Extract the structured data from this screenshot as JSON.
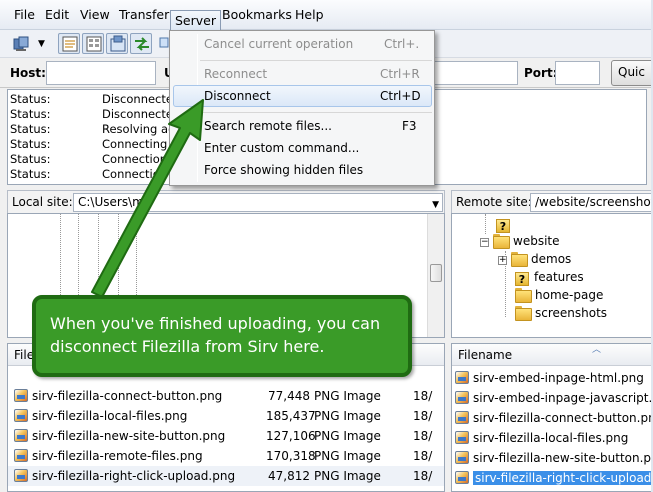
{
  "menubar": {
    "items": [
      "File",
      "Edit",
      "View",
      "Transfer",
      "Server",
      "Bookmarks",
      "Help"
    ]
  },
  "quickconnect": {
    "host_label": "Host:",
    "user_label_partial": "U",
    "port_label": "Port:",
    "button_partial": "Quic"
  },
  "log": {
    "rows": [
      {
        "k": "Status:",
        "v": "Disconnected"
      },
      {
        "k": "Status:",
        "v": "Disconnected"
      },
      {
        "k": "Status:",
        "v": "Resolving ad"
      },
      {
        "k": "Status:",
        "v": "Connecting t"
      },
      {
        "k": "Status:",
        "v": "Connection"
      },
      {
        "k": "Status:",
        "v": "Connection"
      }
    ]
  },
  "server_menu": {
    "items": [
      {
        "label": "Cancel current operation",
        "shortcut": "Ctrl+.",
        "disabled": true
      },
      {
        "label": "Reconnect",
        "shortcut": "Ctrl+R",
        "disabled": true
      },
      {
        "label": "Disconnect",
        "shortcut": "Ctrl+D",
        "disabled": false,
        "highlighted": true
      },
      {
        "label": "Search remote files...",
        "shortcut": "F3",
        "disabled": false
      },
      {
        "label": "Enter custom command...",
        "shortcut": "",
        "disabled": false
      },
      {
        "label": "Force showing hidden files",
        "shortcut": "",
        "disabled": false
      }
    ]
  },
  "local_site": {
    "label": "Local site:",
    "path": "C:\\Users\\m"
  },
  "remote_site": {
    "label": "Remote site:",
    "path": "/website/screenshots"
  },
  "remote_tree": {
    "items": [
      {
        "name": "?",
        "type": "unknown"
      },
      {
        "name": "website",
        "type": "folder-open"
      },
      {
        "name": "demos",
        "type": "folder"
      },
      {
        "name": "features",
        "type": "unknown"
      },
      {
        "name": "home-page",
        "type": "folder"
      },
      {
        "name": "screenshots",
        "type": "folder"
      }
    ]
  },
  "local_list": {
    "header_partial": "File",
    "rows": [
      {
        "name": "sirv-filezilla-connect-button.png",
        "size": "77,448",
        "type": "PNG Image",
        "extra": "18/"
      },
      {
        "name": "sirv-filezilla-local-files.png",
        "size": "185,437",
        "type": "PNG Image",
        "extra": "18/"
      },
      {
        "name": "sirv-filezilla-new-site-button.png",
        "size": "127,106",
        "type": "PNG Image",
        "extra": "18/"
      },
      {
        "name": "sirv-filezilla-remote-files.png",
        "size": "170,318",
        "type": "PNG Image",
        "extra": "18/"
      },
      {
        "name": "sirv-filezilla-right-click-upload.png",
        "size": "47,812",
        "type": "PNG Image",
        "extra": "18/"
      }
    ]
  },
  "remote_list": {
    "header": "Filename",
    "rows": [
      "sirv-embed-inpage-html.png",
      "sirv-embed-inpage-javascript.pn",
      "sirv-filezilla-connect-button.png",
      "sirv-filezilla-local-files.png",
      "sirv-filezilla-new-site-button.png",
      "sirv-filezilla-right-click-upload.pr"
    ]
  },
  "callout": {
    "text": "When you've finished uploading, you can disconnect Filezilla from Sirv here."
  },
  "colors": {
    "callout_fill": "#3a9b28",
    "callout_border": "#1f6b12",
    "selection": "#3b8fe8"
  }
}
